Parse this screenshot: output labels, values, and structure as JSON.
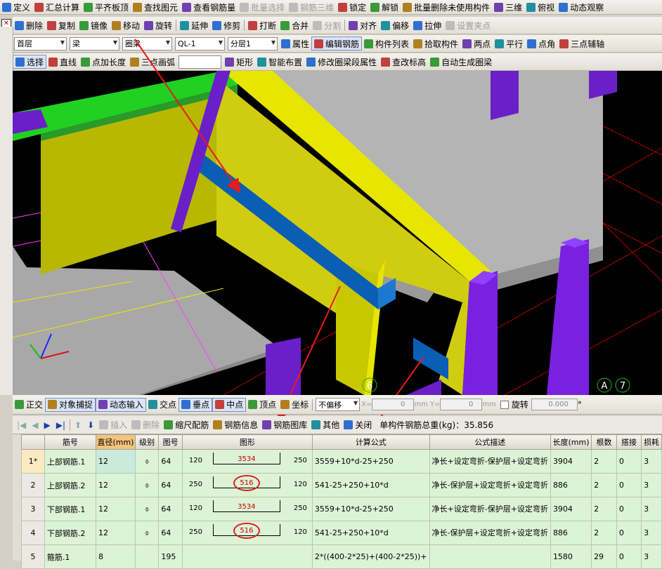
{
  "toolbar1": {
    "items": [
      {
        "label": "定义",
        "icon": "define-icon",
        "disabled": false
      },
      {
        "label": "汇总计算",
        "icon": "sigma-icon",
        "disabled": false
      },
      {
        "label": "平齐板顶",
        "icon": "align-slab-icon",
        "disabled": false
      },
      {
        "label": "查找图元",
        "icon": "binoculars-icon",
        "disabled": false
      },
      {
        "label": "查看钢筋量",
        "icon": "rebar-amount-icon",
        "disabled": false
      },
      {
        "label": "批量选择",
        "icon": "batch-select-icon",
        "disabled": true
      },
      {
        "label": "钢筋三维",
        "icon": "rebar-3d-icon",
        "disabled": true
      },
      {
        "label": "锁定",
        "icon": "lock-icon",
        "disabled": false
      },
      {
        "label": "解锁",
        "icon": "unlock-icon",
        "disabled": false
      },
      {
        "label": "批量删除未使用构件",
        "icon": "batch-delete-icon",
        "disabled": false
      },
      {
        "label": "三维",
        "icon": "cube-icon",
        "disabled": false
      },
      {
        "label": "俯视",
        "icon": "top-view-icon",
        "disabled": false
      },
      {
        "label": "动态观察",
        "icon": "orbit-icon",
        "disabled": false
      }
    ]
  },
  "toolbar2": {
    "items": [
      {
        "label": "删除",
        "icon": "eraser-icon",
        "disabled": false
      },
      {
        "label": "复制",
        "icon": "copy-icon",
        "disabled": false
      },
      {
        "label": "镜像",
        "icon": "mirror-icon",
        "disabled": false
      },
      {
        "label": "移动",
        "icon": "move-icon",
        "disabled": false
      },
      {
        "label": "旋转",
        "icon": "rotate-icon",
        "disabled": false
      },
      {
        "label": "延伸",
        "icon": "extend-icon",
        "disabled": false
      },
      {
        "label": "修剪",
        "icon": "trim-icon",
        "disabled": false
      },
      {
        "label": "打断",
        "icon": "break-icon",
        "disabled": false
      },
      {
        "label": "合并",
        "icon": "merge-icon",
        "disabled": false
      },
      {
        "label": "分割",
        "icon": "split-icon",
        "disabled": true
      },
      {
        "label": "对齐",
        "icon": "align-icon",
        "disabled": false
      },
      {
        "label": "偏移",
        "icon": "offset-icon",
        "disabled": false
      },
      {
        "label": "拉伸",
        "icon": "stretch-icon",
        "disabled": false
      },
      {
        "label": "设置夹点",
        "icon": "grip-icon",
        "disabled": true
      }
    ]
  },
  "toolbar3": {
    "floor": "首层",
    "category": "梁",
    "type": "圈梁",
    "element": "QL-1",
    "layer": "分层1",
    "items": [
      {
        "label": "属性",
        "icon": "properties-icon"
      },
      {
        "label": "编辑钢筋",
        "icon": "edit-rebar-icon"
      },
      {
        "label": "构件列表",
        "icon": "list-icon"
      },
      {
        "label": "拾取构件",
        "icon": "pick-icon"
      },
      {
        "label": "两点",
        "icon": "two-point-icon"
      },
      {
        "label": "平行",
        "icon": "parallel-icon"
      },
      {
        "label": "点角",
        "icon": "point-angle-icon"
      },
      {
        "label": "三点辅轴",
        "icon": "three-point-axis-icon"
      }
    ]
  },
  "toolbar4": {
    "items": [
      {
        "label": "选择",
        "icon": "cursor-icon"
      },
      {
        "label": "直线",
        "icon": "line-icon"
      },
      {
        "label": "点加长度",
        "icon": "point-length-icon"
      },
      {
        "label": "三点画弧",
        "icon": "arc-icon"
      },
      {
        "label": "矩形",
        "icon": "rectangle-icon"
      },
      {
        "label": "智能布置",
        "icon": "smart-layout-icon"
      },
      {
        "label": "修改圈梁段属性",
        "icon": "modify-segment-icon"
      },
      {
        "label": "查改标高",
        "icon": "elevation-icon"
      },
      {
        "label": "自动生成圈梁",
        "icon": "auto-generate-icon"
      }
    ]
  },
  "scene": {
    "axis_labels": [
      "6",
      "A",
      "7"
    ],
    "colors": {
      "background": "#000000",
      "beam": "#c8c800",
      "rebar": "#0a5fb4",
      "column": "#6a1fc8",
      "slab": "#a0a0a0",
      "wall": "#b8b8b8",
      "grid": "#c00000",
      "arrow": "#e81a1a"
    }
  },
  "statusbar": {
    "items": [
      "正交",
      "对象捕捉",
      "动态输入",
      "交点",
      "垂点",
      "中点",
      "顶点",
      "坐标"
    ],
    "offset_mode": "不偏移",
    "x_label": "X=",
    "x_value": "0",
    "y_label": "Y=",
    "y_value": "0",
    "unit": "mm",
    "rotate_label": "旋转",
    "rotate_value": "0.000",
    "degree": "°"
  },
  "grid_toolbar": {
    "items": [
      {
        "label": "插入",
        "disabled": true
      },
      {
        "label": "删除",
        "disabled": true
      },
      {
        "label": "缩尺配筋",
        "disabled": false
      },
      {
        "label": "钢筋信息",
        "disabled": false
      },
      {
        "label": "钢筋图库",
        "disabled": false
      },
      {
        "label": "其他",
        "disabled": false
      },
      {
        "label": "关闭",
        "disabled": false
      }
    ],
    "total_weight": "单构件钢筋总重(kg)：35.856"
  },
  "table": {
    "columns": [
      "筋号",
      "直径(mm)",
      "级别",
      "图号",
      "图形",
      "计算公式",
      "公式描述",
      "长度(mm)",
      "根数",
      "搭接",
      "损耗"
    ],
    "rows": [
      {
        "no": "1*",
        "name": "上部钢筋.1",
        "dia": "12",
        "grade": "⌽",
        "fig": "64",
        "left": "120",
        "mid": "3534",
        "right": "250",
        "formula": "3559+10*d-25+250",
        "desc": "净长+设定弯折-保护层+设定弯折",
        "length": "3904",
        "count": "2",
        "lap": "0",
        "loss": "3",
        "circled": false
      },
      {
        "no": "2",
        "name": "上部钢筋.2",
        "dia": "12",
        "grade": "⌽",
        "fig": "64",
        "left": "250",
        "mid": "516",
        "right": "120",
        "formula": "541-25+250+10*d",
        "desc": "净长-保护层+设定弯折+设定弯折",
        "length": "886",
        "count": "2",
        "lap": "0",
        "loss": "3",
        "circled": true
      },
      {
        "no": "3",
        "name": "下部钢筋.1",
        "dia": "12",
        "grade": "⌽",
        "fig": "64",
        "left": "120",
        "mid": "3534",
        "right": "250",
        "formula": "3559+10*d-25+250",
        "desc": "净长+设定弯折-保护层+设定弯折",
        "length": "3904",
        "count": "2",
        "lap": "0",
        "loss": "3",
        "circled": false
      },
      {
        "no": "4",
        "name": "下部钢筋.2",
        "dia": "12",
        "grade": "⌽",
        "fig": "64",
        "left": "250",
        "mid": "516",
        "right": "120",
        "formula": "541-25+250+10*d",
        "desc": "净长-保护层+设定弯折+设定弯折",
        "length": "886",
        "count": "2",
        "lap": "0",
        "loss": "3",
        "circled": true
      },
      {
        "no": "5",
        "name": "箍筋.1",
        "dia": "8",
        "grade": "",
        "fig": "195",
        "left": "",
        "mid": "",
        "right": "",
        "formula": "2*((400-2*25)+(400-2*25))+",
        "desc": "",
        "length": "1580",
        "count": "29",
        "lap": "0",
        "loss": "3",
        "circled": false
      }
    ]
  }
}
